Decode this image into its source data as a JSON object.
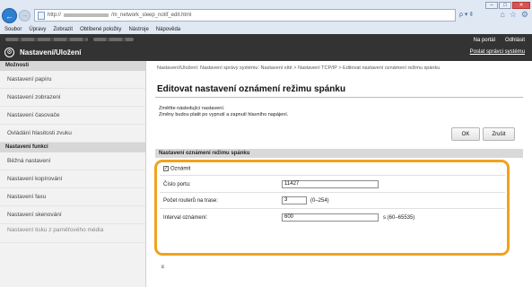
{
  "browser": {
    "address_url": "http://",
    "address_suffix": "/m_network_sleep_notif_edit.html",
    "address_right": "ρ ▾ ¢",
    "menu": [
      "Soubor",
      "Úpravy",
      "Zobrazit",
      "Oblíbené položky",
      "Nástroje",
      "Nápověda"
    ],
    "window_controls": [
      "‒",
      "□",
      "✕"
    ]
  },
  "app": {
    "title": "Nastavení/Uložení",
    "links": [
      "Na portál",
      "Odhlásit"
    ],
    "system_settings_link": "Poslat správci systému"
  },
  "sidebar": {
    "sections": [
      {
        "header": "Možnosti",
        "items": [
          "Nastavení papíru",
          "Nastavení zobrazení",
          "Nastavení časovače",
          "Ovládání hlasitosti zvuku"
        ]
      },
      {
        "header": "Nastavení funkcí",
        "items": [
          "Běžná nastavení",
          "Nastavení kopírování",
          "Nastavení faxu",
          "Nastavení skenování",
          "Nastavení tisku z paměťového média"
        ]
      }
    ]
  },
  "main": {
    "breadcrumb": "Nastavení/Uložení: Nastavení správy systému: Nastavení sítě > Nastavení TCP/IP > Editovat nastavení oznámení režimu spánku",
    "title": "Editovat nastavení oznámení režimu spánku",
    "info_line1": "Změňte následující nastavení.",
    "info_line2": "Změny budou platit po vypnutí a zapnutí hlavního napájení.",
    "ok_label": "OK",
    "cancel_label": "Zrušit",
    "section_header": "Nastavení oznámení režimu spánku",
    "notify_label": "Oznámit",
    "notify_checked": true,
    "port_label": "Číslo portu:",
    "port_value": "11427",
    "routers_label": "Počet routerů na trase:",
    "routers_value": "3",
    "routers_range": "(0–254)",
    "interval_label": "Interval oznámení:",
    "interval_value": "600",
    "interval_range": "s (60–65535)",
    "to_top": "⌅"
  },
  "colors": {
    "header_bg": "#333333",
    "highlight": "#f0a21e",
    "chrome_bg": "#dfe8f3"
  }
}
